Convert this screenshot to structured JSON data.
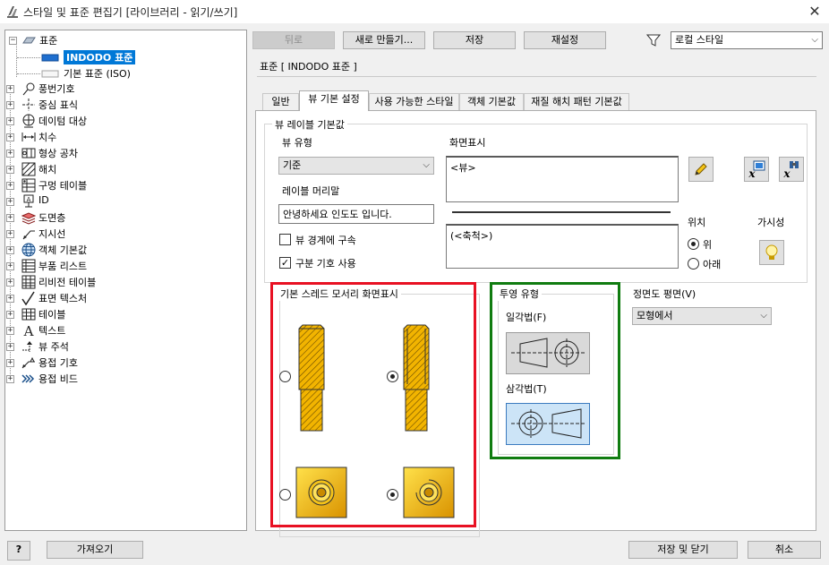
{
  "window": {
    "title": "스타일 및 표준 편집기 [라이브러리 - 읽기/쓰기]",
    "close_glyph": "✕"
  },
  "toolbar": {
    "back_label": "뒤로",
    "new_label": "새로 만들기...",
    "save_label": "저장",
    "reset_label": "재설정",
    "filter_value": "로컬 스타일"
  },
  "tree": {
    "root_label": "표준",
    "standards": [
      {
        "label": "INDODO 표준",
        "selected": true
      },
      {
        "label": "기본 표준 (ISO)",
        "selected": false
      }
    ],
    "categories": [
      {
        "label": "풍번기호",
        "icon": "balloon-icon"
      },
      {
        "label": "중심 표식",
        "icon": "center-mark-icon"
      },
      {
        "label": "데이텀 대상",
        "icon": "datum-target-icon"
      },
      {
        "label": "치수",
        "icon": "dimension-icon"
      },
      {
        "label": "형상 공차",
        "icon": "feature-control-frame-icon"
      },
      {
        "label": "해치",
        "icon": "hatch-icon"
      },
      {
        "label": "구멍 테이블",
        "icon": "hole-table-icon"
      },
      {
        "label": "ID",
        "icon": "id-icon"
      },
      {
        "label": "도면층",
        "icon": "layers-icon"
      },
      {
        "label": "지시선",
        "icon": "leader-icon"
      },
      {
        "label": "객체 기본값",
        "icon": "object-defaults-icon"
      },
      {
        "label": "부품 리스트",
        "icon": "parts-list-icon"
      },
      {
        "label": "리비전 테이블",
        "icon": "revision-table-icon"
      },
      {
        "label": "표면 텍스처",
        "icon": "surface-texture-icon"
      },
      {
        "label": "테이블",
        "icon": "table-icon"
      },
      {
        "label": "텍스트",
        "icon": "text-icon"
      },
      {
        "label": "뷰 주석",
        "icon": "view-annotation-icon"
      },
      {
        "label": "용접 기호",
        "icon": "weld-symbol-icon"
      },
      {
        "label": "용접 비드",
        "icon": "weld-bead-icon"
      }
    ]
  },
  "header": {
    "standard_title": "표준 [ INDODO 표준 ]"
  },
  "tabs": [
    {
      "label": "일반",
      "active": false
    },
    {
      "label": "뷰 기본 설정",
      "active": true
    },
    {
      "label": "사용 가능한 스타일",
      "active": false
    },
    {
      "label": "객체 기본값",
      "active": false
    },
    {
      "label": "재질 해치 패턴 기본값",
      "active": false
    }
  ],
  "view_label_defaults": {
    "group_title": "뷰 레이블 기본값",
    "view_type_label": "뷰 유형",
    "view_type_value": "기준",
    "display_label": "화면표시",
    "display_line1": "<뷰>",
    "display_line2": "(<축척>)",
    "prefix_label": "레이블 머리말",
    "prefix_value": "안녕하세요 인도도 입니다.",
    "constrain_label": "뷰 경계에 구속",
    "constrain_checked": false,
    "delimiter_label": "구분 기호 사용",
    "delimiter_checked": true,
    "position_label": "위치",
    "position_top": "위",
    "position_bottom": "아래",
    "position_selected": "top",
    "visibility_label": "가시성"
  },
  "thread_display": {
    "group_title": "기본 스레드 모서리 화면표시",
    "selected_side_option": "partial",
    "selected_end_option": "partial"
  },
  "projection": {
    "group_title": "투영 유형",
    "first_angle_label": "일각법(F)",
    "third_angle_label": "삼각법(T)",
    "selected": "third"
  },
  "front_plane": {
    "label": "정면도 평면(V)",
    "value": "모형에서"
  },
  "footer": {
    "help_glyph": "?",
    "import_label": "가져오기",
    "save_close_label": "저장 및 닫기",
    "cancel_label": "취소"
  },
  "colors": {
    "selection": "#0078d7",
    "thread_highlight": "#e81123",
    "projection_highlight": "#107c10",
    "thread_gold": "#f2b400"
  }
}
